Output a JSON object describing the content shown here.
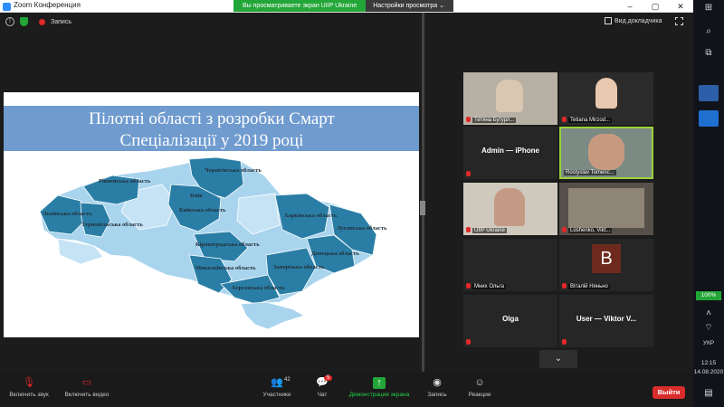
{
  "window": {
    "title": "Zoom Конференция",
    "controls": [
      "–",
      "▢",
      "✕"
    ]
  },
  "share_banner": {
    "status_text": "Вы просматриваете экран UIIP Ukraine",
    "settings_label": "Настройки просмотра"
  },
  "meeting_top": {
    "record_label": "Запись",
    "view_label": "Вид докладчика"
  },
  "slide": {
    "title_line1": "Пілотні області з розробки Смарт",
    "title_line2": "Спеціалізації у 2019 році",
    "regions": [
      "Чернігівська область",
      "Рівненська область",
      "Київ",
      "Київська область",
      "Львівська область",
      "Тернопільська область",
      "Харківська область",
      "Луганська область",
      "Кіровоградська область",
      "Донецька область",
      "Миколаївська область",
      "Запорізька область",
      "Херсонська область"
    ],
    "colors": {
      "highlighted": "#2a7ea6",
      "base": "#a9d4ee",
      "light": "#c6e3f6",
      "crimea": "#a9d4ee",
      "header": "#6f9bcf"
    }
  },
  "participants": [
    {
      "name": "Тетяна Бугурл...",
      "type": "video"
    },
    {
      "name": "Tetiana Mirzod...",
      "type": "video"
    },
    {
      "name": "Admin — iPhone",
      "type": "name"
    },
    {
      "name": "Rostyslav Tomenc...",
      "type": "video",
      "active": true
    },
    {
      "name": "UIIP Ukraine",
      "type": "video"
    },
    {
      "name": "Loshenko, Vikt...",
      "type": "video"
    },
    {
      "name": "Мних Ольга",
      "type": "name-only"
    },
    {
      "name": "Віталій Няньно",
      "type": "avatar",
      "initial": "B"
    },
    {
      "name": "Olga",
      "type": "name"
    },
    {
      "name": "User — Viktor V...",
      "type": "name"
    }
  ],
  "toolbar": {
    "audio_label": "Включить звук",
    "video_label": "Включить видео",
    "participants_label": "Участники",
    "participants_count": "42",
    "chat_label": "Чат",
    "chat_badge": "5",
    "share_label": "Демонстрация экрана",
    "record_label": "Запись",
    "reactions_label": "Реакции",
    "leave_label": "Выйти"
  },
  "taskbar": {
    "battery": "100%",
    "language": "УКР",
    "time": "12:15",
    "date": "14.08.2020"
  }
}
